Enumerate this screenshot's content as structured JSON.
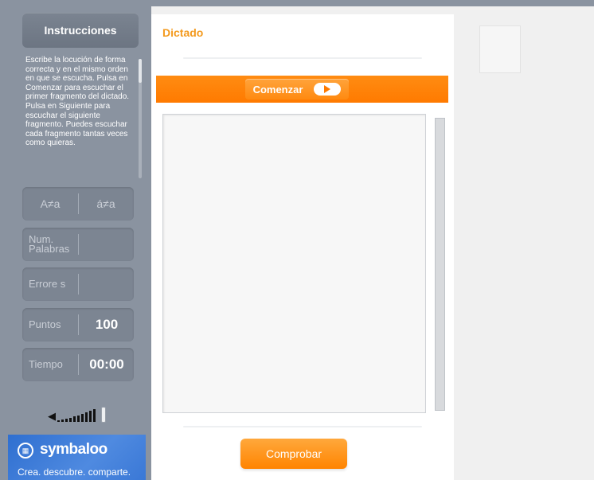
{
  "sidebar": {
    "instructions_button": "Instrucciones",
    "instructions_text": "Escribe la locución de forma correcta y en el mismo orden en que se escucha. Pulsa en Comenzar para escuchar el primer fragmento del dictado. Pulsa en Siguiente para escuchar el siguiente fragmento. Puedes escuchar cada fragmento tantas veces como quieras.",
    "case_toggle_upper": "A≠a",
    "case_toggle_accent": "á≠a",
    "num_words_label": "Num. Palabras",
    "num_words_value": "",
    "errors_label": "Errore s",
    "errors_value": "",
    "points_label": "Puntos",
    "points_value": "100",
    "time_label": "Tiempo",
    "time_value": "00:00",
    "volume_icon": "speaker-icon"
  },
  "footer_banner": {
    "brand": "symbaloo",
    "tagline": "Crea. descubre. comparte."
  },
  "main": {
    "title": "Dictado",
    "start_button": "Comenzar",
    "play_icon": "play-icon",
    "answer_value": "",
    "check_button": "Comprobar"
  },
  "colors": {
    "accent_orange": "#ff7a00",
    "title_orange": "#f39a1e",
    "sidebar_gray": "#8a93a0",
    "brand_blue": "#2f6fd0"
  }
}
